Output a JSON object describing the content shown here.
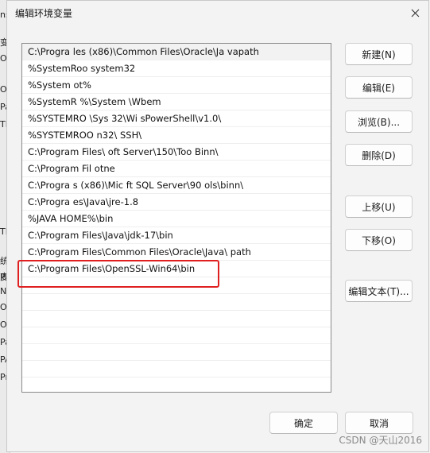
{
  "dialog": {
    "title": "编辑环境变量",
    "close_icon": "close-icon"
  },
  "background_fragments": [
    "ns",
    "变",
    "Or",
    "Or",
    "Pa",
    "TE",
    "TM",
    "统",
    "变",
    "Ni",
    "Or",
    "Os",
    "Pa",
    "PA",
    "Pro",
    "PR"
  ],
  "path_entries": [
    "C:\\Progra      les (x86)\\Common Files\\Oracle\\Ja        vapath",
    "%SystemRoo    system32",
    "%System   ot%",
    "%SystemR      %\\System    \\Wbem",
    "%SYSTEMRO      \\Sys    32\\Wi          sPowerShell\\v1.0\\",
    "%SYSTEMROO        n32\\     SSH\\",
    "C:\\Program Files\\        oft      Server\\150\\Too      Binn\\",
    "C:\\Program Fil       otne",
    "C:\\Progra      s (x86)\\Mic      ft SQL Server\\90        ols\\binn\\",
    "C:\\Progra      es\\Java\\jre-1.8",
    "%JAVA HOME%\\bin",
    "C:\\Program Files\\Java\\jdk-17\\bin",
    "C:\\Program Files\\Common Files\\Oracle\\Java\\      path",
    "C:\\Program Files\\OpenSSL-Win64\\bin",
    "",
    "",
    "",
    "",
    "",
    "",
    ""
  ],
  "buttons": {
    "new": "新建(N)",
    "edit": "编辑(E)",
    "browse": "浏览(B)...",
    "delete": "删除(D)",
    "move_up": "上移(U)",
    "move_down": "下移(O)",
    "edit_text": "编辑文本(T)...",
    "ok": "确定",
    "cancel": "取消"
  },
  "watermark": "CSDN @天山2016"
}
